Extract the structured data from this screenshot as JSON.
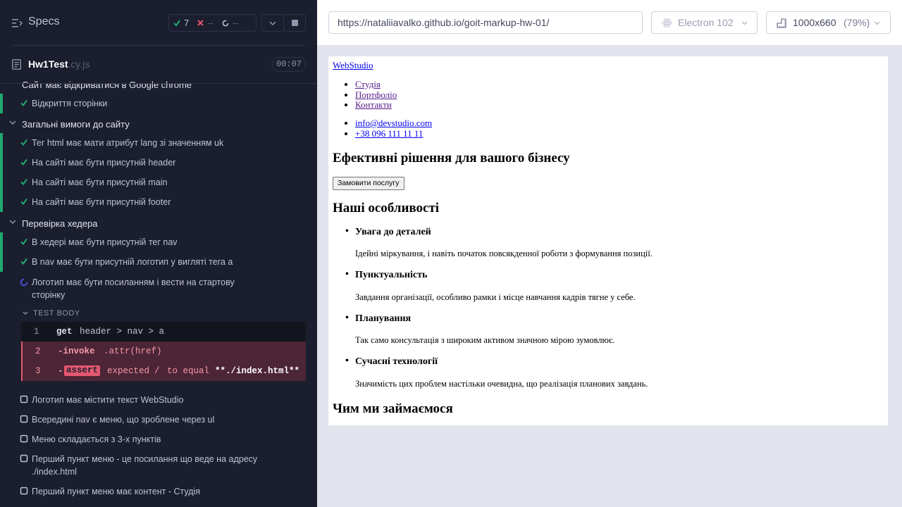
{
  "reporter": {
    "title": "Specs",
    "stats": {
      "passed": "7",
      "failed": "--",
      "pending": "--"
    },
    "file": {
      "name": "Hw1Test",
      "ext": ".cy.js",
      "duration": "00:07"
    },
    "tests": {
      "partial_suite": "Сайт має відкриватися в Google chrome",
      "t0": "Відкриття сторінки",
      "suite1": "Загальні вимоги до сайту",
      "t1": "Тег html має мати атрибут lang зі значенням uk",
      "t2": "На сайті має бути присутній header",
      "t3": "На сайті має бути присутній main",
      "t4": "На сайті має бути присутній footer",
      "suite2": "Перевірка хедера",
      "t5": "В хедері має бути присутній тег nav",
      "t6": "В nav має бути присутній логотип у вигляті тега a",
      "t7": "Логотип має бути посиланням і вести на стартову сторінку",
      "test_body_label": "TEST BODY",
      "commands": [
        {
          "line": "1",
          "name": "get",
          "arg": "header > nav > a",
          "arg2": ""
        },
        {
          "line": "2",
          "name": "-invoke",
          "arg": ".attr(href)",
          "arg2": ""
        },
        {
          "line": "3",
          "name": "-",
          "badge": "assert",
          "arg": "expected",
          "arg2": "/",
          "arg3": "to equal",
          "arg4": "**./index.html**"
        }
      ],
      "t8": "Логотип має містити текст WebStudio",
      "t9": "Всередині nav є меню, що зроблене через ul",
      "t10": "Меню складається з 3-х пунктів",
      "t11": "Перший пункт меню - це посилання що веде на адресу ./index.html",
      "t12": "Перший пункт меню має контент - Студія"
    }
  },
  "browser": {
    "url": "https://nataliiavalko.github.io/goit-markup-hw-01/",
    "browser_name": "Electron 102",
    "viewport": "1000x660",
    "zoom": "(79%)"
  },
  "aut": {
    "logo": "WebStudio",
    "nav": [
      "Студія",
      "Портфоліо",
      "Контакти"
    ],
    "contacts": [
      "info@devstudio.com",
      "+38 096 111 11 11"
    ],
    "hero_title": "Ефективні рішення для вашого бізнесу",
    "hero_button": "Замовити послугу",
    "features_title": "Наші особливості",
    "features": [
      {
        "title": "Увага до деталей",
        "desc": "Ідейні міркування, і навіть початок повсякденної роботи з формування позиції."
      },
      {
        "title": "Пунктуальність",
        "desc": "Завдання організації, особливо рамки і місце навчання кадрів тягне у себе."
      },
      {
        "title": "Планування",
        "desc": "Так само консультація з широким активом значною мірою зумовлює."
      },
      {
        "title": "Сучасні технології",
        "desc": "Значимість цих проблем настільки очевидна, що реалізація планових завдань."
      }
    ],
    "services_title": "Чим ми займаємося"
  },
  "colors": {
    "pass": "#1fa971",
    "fail": "#e45770",
    "running": "#4956e3",
    "panel": "#1b1e2e"
  }
}
